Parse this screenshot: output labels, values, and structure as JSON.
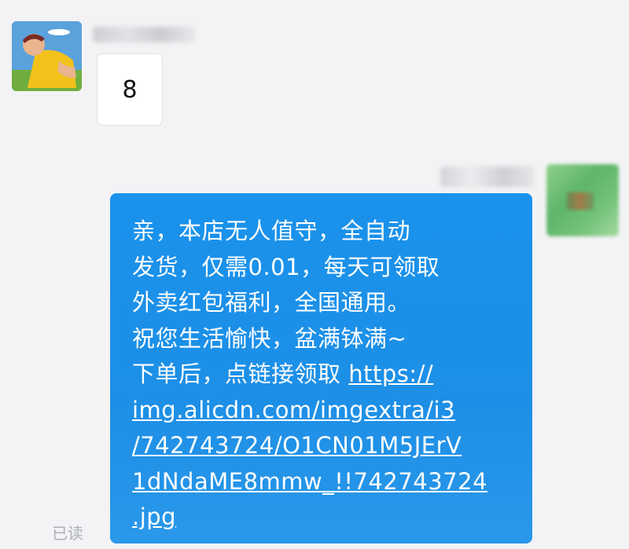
{
  "chat": {
    "left_message": {
      "text": "8"
    },
    "right_message": {
      "lines": [
        "亲，本店无人值守，全自动",
        "发货，仅需0.01，每天可领取",
        "外卖红包福利，全国通用。",
        "祝您生活愉快，盆满钵满~",
        "下单后，点链接领取 "
      ],
      "link_lines": [
        "https://",
        "img.alicdn.com/imgextra/i3",
        "/742743724/O1CN01M5JErV",
        "1dNdaME8mmw_!!742743724",
        ".jpg"
      ]
    },
    "read_status": "已读"
  },
  "colors": {
    "bubble_blue": "#1d8fe6",
    "background": "#f3f3f5"
  }
}
